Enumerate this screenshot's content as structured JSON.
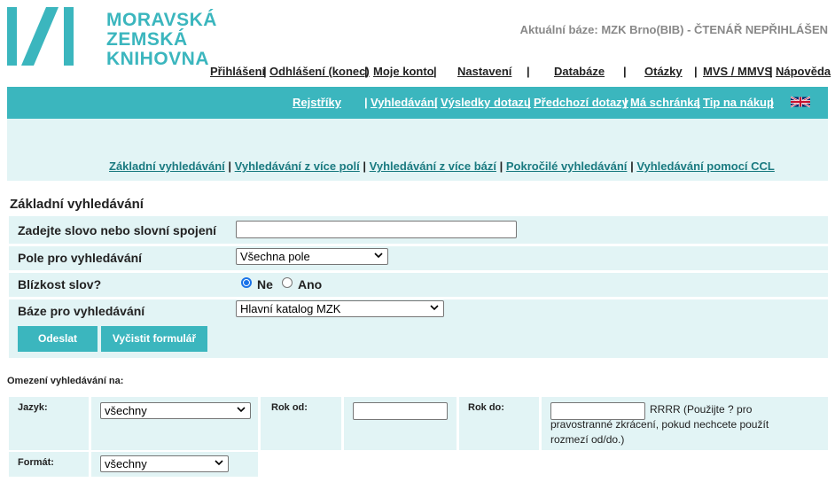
{
  "logo": {
    "line1": "MORAVSKÁ",
    "line2": "ZEMSKÁ",
    "line3": "KNIHOVNA"
  },
  "status": "Aktuální báze: MZK Brno(BIB) - ČTENÁŘ NEPŘIHLÁŠEN",
  "topnav": {
    "login": "Přihlášení",
    "logout": "Odhlášení (konec)",
    "account": "Moje konto",
    "settings": "Nastavení",
    "databases": "Databáze",
    "questions": "Otázky",
    "mvs": "MVS / MMVS",
    "help": "Nápověda"
  },
  "bar1": {
    "registers": "Rejstříky",
    "search": "Vyhledávání",
    "results": "Výsledky dotazu",
    "previous": "Předchozí dotazy",
    "basket": "Má schránka",
    "tip": "Tip na nákup"
  },
  "bar2": {
    "basic": "Základní vyhledávání",
    "multi_field": "Vyhledávání z více polí",
    "multi_base": "Vyhledávání z více bází",
    "advanced": "Pokročilé vyhledávání",
    "ccl": "Vyhledávání pomocí CCL"
  },
  "form": {
    "title": "Základní vyhledávání",
    "query_label": "Zadejte slovo nebo slovní spojení",
    "query_value": "",
    "field_label": "Pole pro vyhledávání",
    "field_value": "Všechna pole",
    "proximity_label": "Blízkost slov?",
    "proximity_no": "Ne",
    "proximity_yes": "Ano",
    "proximity_selected": "Ne",
    "base_label": "Báze pro vyhledávání",
    "base_value": "Hlavní katalog MZK",
    "submit": "Odeslat",
    "clear": "Vyčistit formulář"
  },
  "limits": {
    "title": "Omezení vyhledávání na:",
    "language_label": "Jazyk:",
    "language_value": "všechny",
    "year_from_label": "Rok od:",
    "year_from_value": "",
    "year_to_label": "Rok do:",
    "year_to_value": "",
    "year_hint": "RRRR (Použijte ? pro pravostranné zkrácení, pokud nechcete použít rozmezí od/do.)",
    "format_label": "Formát:",
    "format_value": "všechny"
  },
  "colors": {
    "accent": "#3bb6be",
    "panel": "#e2f4f5"
  }
}
